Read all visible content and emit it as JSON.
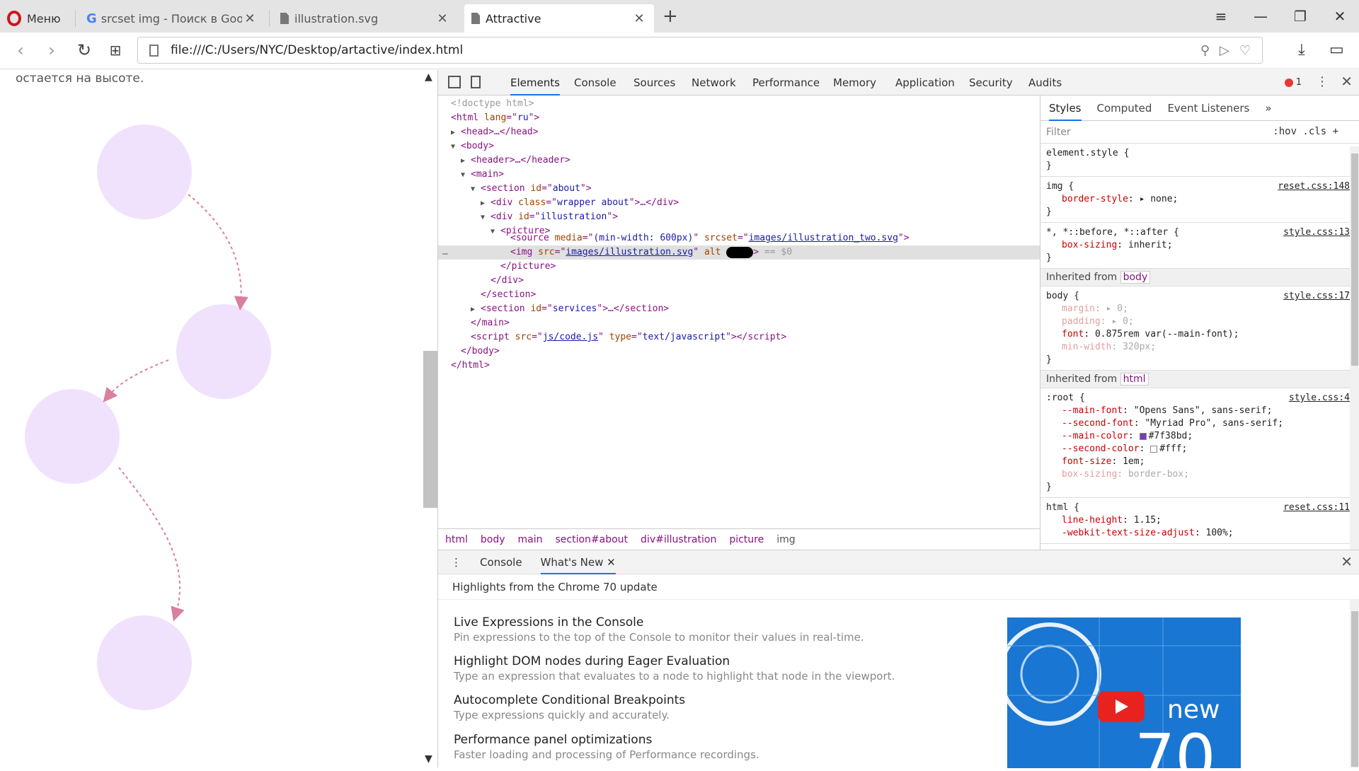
{
  "browser": {
    "menu_label": "Меню",
    "tabs": [
      {
        "title": "srcset img - Поиск в Goog"
      },
      {
        "title": "illustration.svg"
      },
      {
        "title": "Attractive"
      }
    ],
    "address": "file:///C:/Users/NYC/Desktop/artactive/index.html"
  },
  "page": {
    "top_text": "остается на высоте."
  },
  "devtools": {
    "tabs": [
      "Elements",
      "Console",
      "Sources",
      "Network",
      "Performance",
      "Memory",
      "Application",
      "Security",
      "Audits"
    ],
    "error_count": "1",
    "breadcrumb": [
      "html",
      "body",
      "main",
      "section#about",
      "div#illustration",
      "picture",
      "img"
    ],
    "tree": {
      "doctype": "<!doctype html>",
      "html_lang": "ru",
      "source_media": "(min-width: 600px)",
      "source_srcset": "images/illustration_two.svg",
      "img_src": "images/illustration.svg",
      "img_suffix": "== $0",
      "section_about_id": "about",
      "div_wrapper_class": "wrapper about",
      "div_illus_id": "illustration",
      "section_services_id": "services",
      "script_src": "js/code.js",
      "script_type": "text/javascript"
    },
    "styles": {
      "tabs": [
        "Styles",
        "Computed",
        "Event Listeners"
      ],
      "filter_placeholder": "Filter",
      "filter_tools": ":hov  .cls  +",
      "element_style": "element.style {",
      "img_rule": {
        "selector": "img {",
        "src": "reset.css:148",
        "prop": "border-style",
        "value": "none;"
      },
      "universal_rule": {
        "selector": "*, *::before, *::after {",
        "src": "style.css:13",
        "prop": "box-sizing",
        "value": "inherit;"
      },
      "inherited_body": "Inherited from",
      "body_tag": "body",
      "body_rule": {
        "selector": "body {",
        "src": "style.css:17",
        "margin": "margin",
        "margin_v": "0;",
        "padding": "padding",
        "padding_v": "0;",
        "font": "font",
        "font_v": "0.875rem var(--main-font);",
        "minw": "min-width",
        "minw_v": "320px;"
      },
      "html_tag": "html",
      "root_rule": {
        "selector": ":root {",
        "src": "style.css:4",
        "p1": "--main-font",
        "v1": "\"Opens Sans\", sans-serif;",
        "p2": "--second-font",
        "v2": "\"Myriad Pro\", sans-serif;",
        "p3": "--main-color",
        "v3": "#7f38bd;",
        "p4": "--second-color",
        "v4": "#fff;",
        "p5": "font-size",
        "v5": "1em;",
        "p6": "box-sizing",
        "v6": "border-box;"
      },
      "html_rule": {
        "selector": "html {",
        "src": "reset.css:11",
        "prop": "line-height",
        "value": "1.15;",
        "prop2": "-webkit-text-size-adjust",
        "value2": "100%;"
      },
      "main_color": "#7f38bd",
      "second_color": "#ffffff"
    },
    "drawer": {
      "tabs": [
        "Console",
        "What's New"
      ],
      "highlights": "Highlights from the Chrome 70 update",
      "features": [
        {
          "title": "Live Expressions in the Console",
          "desc": "Pin expressions to the top of the Console to monitor their values in real-time."
        },
        {
          "title": "Highlight DOM nodes during Eager Evaluation",
          "desc": "Type an expression that evaluates to a node to highlight that node in the viewport."
        },
        {
          "title": "Autocomplete Conditional Breakpoints",
          "desc": "Type expressions quickly and accurately."
        },
        {
          "title": "Performance panel optimizations",
          "desc": "Faster loading and processing of Performance recordings."
        }
      ],
      "promo_new": "new",
      "promo_num": "70"
    }
  }
}
